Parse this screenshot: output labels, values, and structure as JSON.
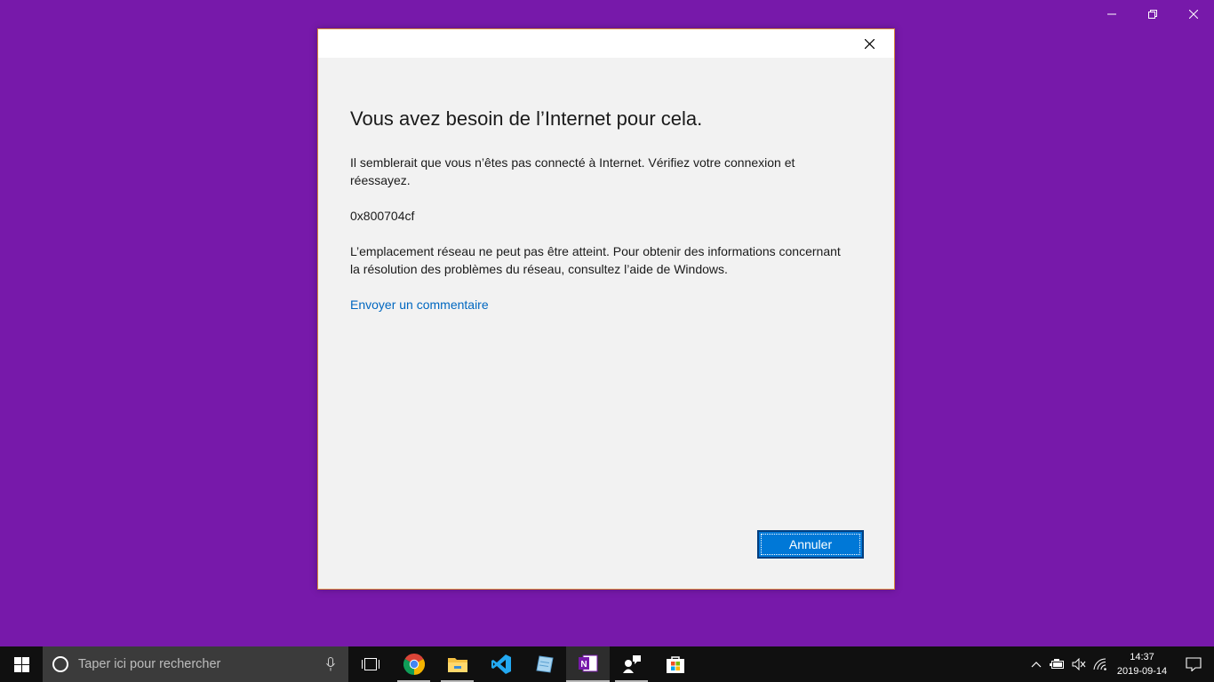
{
  "window_controls": {
    "minimize": "minimize-icon",
    "restore": "restore-icon",
    "close": "close-icon"
  },
  "dialog": {
    "title": "Vous avez besoin de l’Internet pour cela.",
    "message1": "Il semblerait que vous n’êtes pas connecté à Internet. Vérifiez votre connexion et réessayez.",
    "error_code": "0x800704cf",
    "message2": "L’emplacement réseau ne peut pas être atteint. Pour obtenir des informations concernant la résolution des problèmes du réseau, consultez l’aide de Windows.",
    "feedback_link": "Envoyer un commentaire",
    "cancel_label": "Annuler"
  },
  "taskbar": {
    "search_placeholder": "Taper ici pour rechercher",
    "apps": [
      "task-view",
      "chrome",
      "file-explorer",
      "vscode",
      "notepad-plus",
      "onenote",
      "feedback-hub",
      "microsoft-store"
    ],
    "clock_time": "14:37",
    "clock_date": "2019-09-14"
  },
  "colors": {
    "desktop": "#7719aa",
    "accent": "#0078d7",
    "link": "#0067c0"
  }
}
